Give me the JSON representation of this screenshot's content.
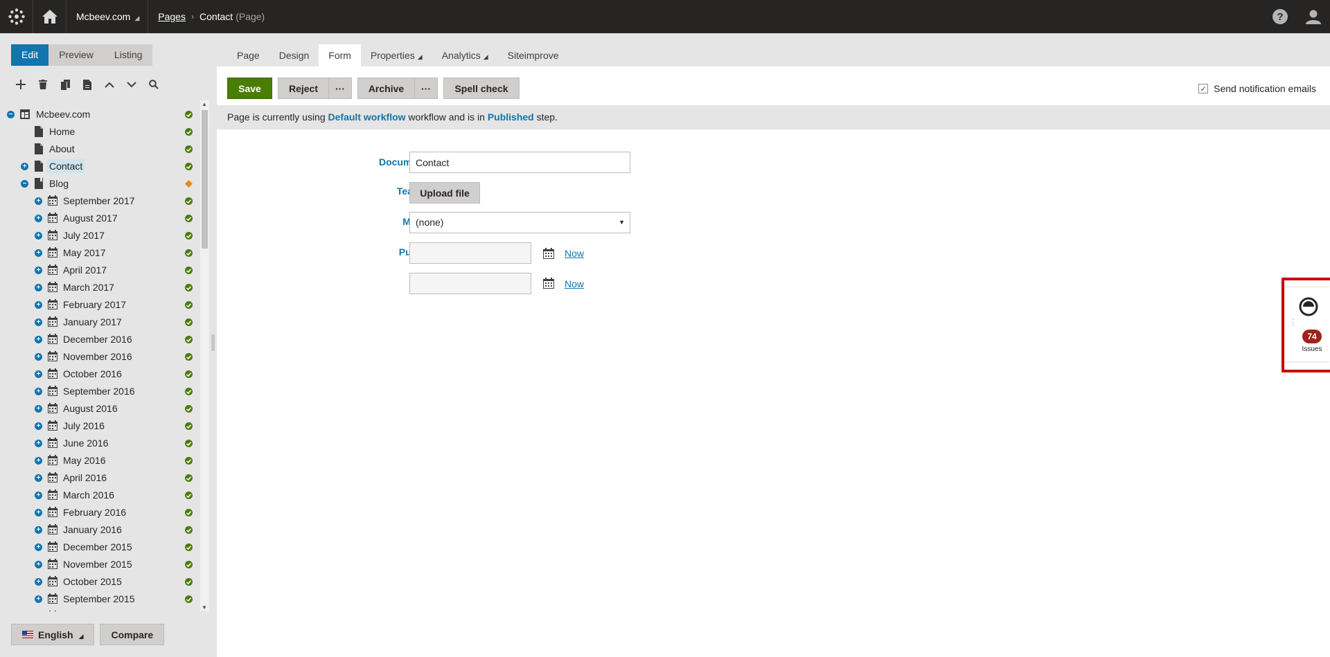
{
  "topbar": {
    "site_name": "Mcbeev.com",
    "breadcrumb_root": "Pages",
    "breadcrumb_current": "Contact",
    "breadcrumb_type": "(Page)"
  },
  "left": {
    "modes": [
      "Edit",
      "Preview",
      "Listing"
    ],
    "active_mode": "Edit",
    "tree": [
      {
        "label": "Mcbeev.com",
        "level": 0,
        "toggle": "minus",
        "icon": "site",
        "status": "published"
      },
      {
        "label": "Home",
        "level": 1,
        "toggle": "",
        "icon": "page",
        "status": "published"
      },
      {
        "label": "About",
        "level": 1,
        "toggle": "",
        "icon": "page",
        "status": "published"
      },
      {
        "label": "Contact",
        "level": 1,
        "toggle": "plus",
        "icon": "page",
        "status": "published",
        "selected": true
      },
      {
        "label": "Blog",
        "level": 1,
        "toggle": "minus",
        "icon": "blog",
        "status": "pending"
      },
      {
        "label": "September 2017",
        "level": 2,
        "toggle": "plus",
        "icon": "calendar",
        "status": "published"
      },
      {
        "label": "August 2017",
        "level": 2,
        "toggle": "plus",
        "icon": "calendar",
        "status": "published"
      },
      {
        "label": "July 2017",
        "level": 2,
        "toggle": "plus",
        "icon": "calendar",
        "status": "published"
      },
      {
        "label": "May 2017",
        "level": 2,
        "toggle": "plus",
        "icon": "calendar",
        "status": "published"
      },
      {
        "label": "April 2017",
        "level": 2,
        "toggle": "plus",
        "icon": "calendar",
        "status": "published"
      },
      {
        "label": "March 2017",
        "level": 2,
        "toggle": "plus",
        "icon": "calendar",
        "status": "published"
      },
      {
        "label": "February 2017",
        "level": 2,
        "toggle": "plus",
        "icon": "calendar",
        "status": "published"
      },
      {
        "label": "January 2017",
        "level": 2,
        "toggle": "plus",
        "icon": "calendar",
        "status": "published"
      },
      {
        "label": "December 2016",
        "level": 2,
        "toggle": "plus",
        "icon": "calendar",
        "status": "published"
      },
      {
        "label": "November 2016",
        "level": 2,
        "toggle": "plus",
        "icon": "calendar",
        "status": "published"
      },
      {
        "label": "October 2016",
        "level": 2,
        "toggle": "plus",
        "icon": "calendar",
        "status": "published"
      },
      {
        "label": "September 2016",
        "level": 2,
        "toggle": "plus",
        "icon": "calendar",
        "status": "published"
      },
      {
        "label": "August 2016",
        "level": 2,
        "toggle": "plus",
        "icon": "calendar",
        "status": "published"
      },
      {
        "label": "July 2016",
        "level": 2,
        "toggle": "plus",
        "icon": "calendar",
        "status": "published"
      },
      {
        "label": "June 2016",
        "level": 2,
        "toggle": "plus",
        "icon": "calendar",
        "status": "published"
      },
      {
        "label": "May 2016",
        "level": 2,
        "toggle": "plus",
        "icon": "calendar",
        "status": "published"
      },
      {
        "label": "April 2016",
        "level": 2,
        "toggle": "plus",
        "icon": "calendar",
        "status": "published"
      },
      {
        "label": "March 2016",
        "level": 2,
        "toggle": "plus",
        "icon": "calendar",
        "status": "published"
      },
      {
        "label": "February 2016",
        "level": 2,
        "toggle": "plus",
        "icon": "calendar",
        "status": "published"
      },
      {
        "label": "January 2016",
        "level": 2,
        "toggle": "plus",
        "icon": "calendar",
        "status": "published"
      },
      {
        "label": "December 2015",
        "level": 2,
        "toggle": "plus",
        "icon": "calendar",
        "status": "published"
      },
      {
        "label": "November 2015",
        "level": 2,
        "toggle": "plus",
        "icon": "calendar",
        "status": "published"
      },
      {
        "label": "October 2015",
        "level": 2,
        "toggle": "plus",
        "icon": "calendar",
        "status": "published"
      },
      {
        "label": "September 2015",
        "level": 2,
        "toggle": "plus",
        "icon": "calendar",
        "status": "published"
      },
      {
        "label": "August 2015",
        "level": 2,
        "toggle": "plus",
        "icon": "calendar",
        "status": "published"
      }
    ],
    "language_label": "English",
    "compare_label": "Compare"
  },
  "main": {
    "tabs": [
      "Page",
      "Design",
      "Form",
      "Properties",
      "Analytics",
      "Siteimprove"
    ],
    "active_tab": "Form",
    "actions": {
      "save": "Save",
      "reject": "Reject",
      "more": "···",
      "archive": "Archive",
      "spell_check": "Spell check"
    },
    "notify_label": "Send notification emails",
    "notify_checked": true,
    "info": {
      "prefix": "Page is currently using ",
      "workflow": "Default workflow",
      "middle": " workflow and is in ",
      "step": "Published",
      "suffix": " step."
    },
    "form": {
      "document_name_label": "Document name:",
      "required_mark": "*",
      "document_name_value": "Contact",
      "teaser_label": "Teaser image:",
      "upload_label": "Upload file",
      "menu_group_label": "Menu group:",
      "menu_group_value": "(none)",
      "publish_from_label": "Publish from:",
      "publish_to_label": "Publish to:",
      "now_label": "Now"
    }
  },
  "siteimprove": {
    "issues_count": "74",
    "issues_label": "Issues"
  },
  "colors": {
    "accent_blue": "#1175ae",
    "save_green": "#497d04",
    "topbar": "#262524",
    "highlight_red": "#cc0000",
    "issues_badge": "#a0221b"
  }
}
